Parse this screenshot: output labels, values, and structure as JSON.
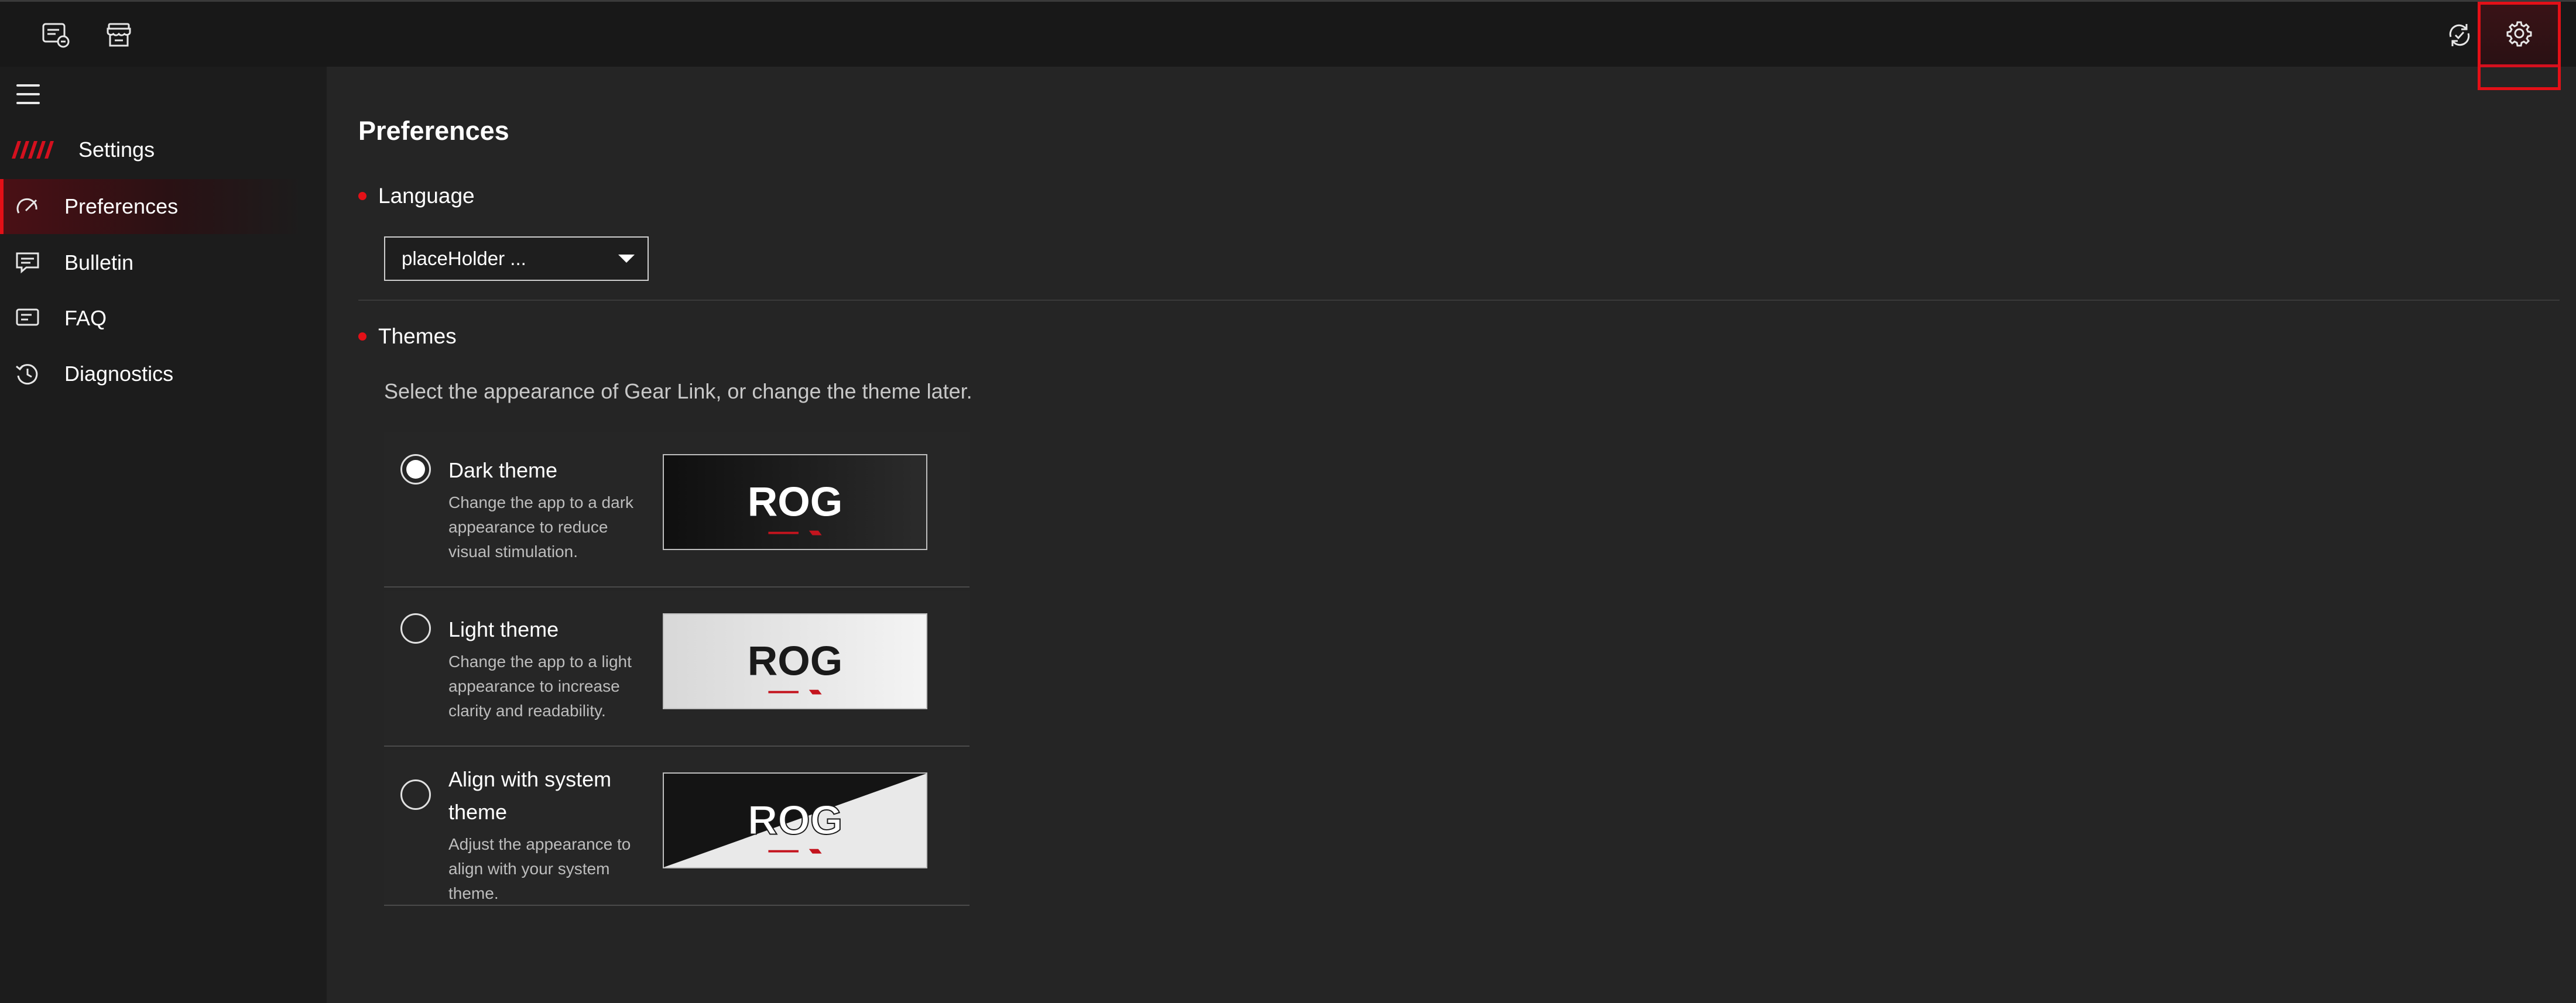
{
  "topbar": {
    "icons": [
      "device-dashboard-icon",
      "store-icon"
    ],
    "right_icons": [
      "sync-icon",
      "gear-icon"
    ]
  },
  "sidebar": {
    "brand_label": "Settings",
    "items": [
      {
        "label": "Preferences",
        "icon": "preferences-icon",
        "active": true
      },
      {
        "label": "Bulletin",
        "icon": "bulletin-icon",
        "active": false
      },
      {
        "label": "FAQ",
        "icon": "faq-icon",
        "active": false
      },
      {
        "label": "Diagnostics",
        "icon": "diagnostics-icon",
        "active": false
      }
    ]
  },
  "main": {
    "title": "Preferences",
    "language": {
      "label": "Language",
      "selected": "placeHolder ..."
    },
    "themes": {
      "label": "Themes",
      "description": "Select the appearance of Gear Link, or change the theme later.",
      "options": [
        {
          "title": "Dark theme",
          "description": "Change the app to a dark appearance to reduce visual stimulation.",
          "selected": true,
          "preview_logo": "ROG"
        },
        {
          "title": "Light theme",
          "description": "Change the app to a light appearance to increase clarity and readability.",
          "selected": false,
          "preview_logo": "ROG"
        },
        {
          "title": "Align with system theme",
          "description": "Adjust the appearance to align with your system theme.",
          "selected": false,
          "preview_logo": "ROG"
        }
      ]
    }
  },
  "colors": {
    "accent": "#e31017",
    "background": "#252525",
    "sidebar": "#1c1c1c",
    "topbar": "#181818"
  }
}
